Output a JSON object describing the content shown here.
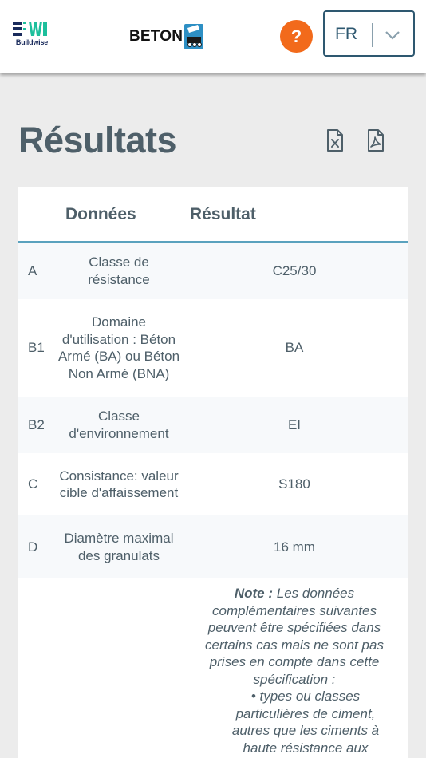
{
  "header": {
    "bw_brand": "Buildwise",
    "beton_brand": "BETON",
    "help_label": "?",
    "language": "FR"
  },
  "page": {
    "title": "Résultats"
  },
  "table": {
    "headers": [
      "Données",
      "Résultat"
    ],
    "rows": [
      {
        "code": "A",
        "label": "Classe de résistance",
        "value": "C25/30"
      },
      {
        "code": "B1",
        "label": "Domaine d'utilisation : Béton Armé (BA) ou Béton Non Armé (BNA)",
        "value": "BA"
      },
      {
        "code": "B2",
        "label": "Classe d'environnement",
        "value": "EI"
      },
      {
        "code": "C",
        "label": "Consistance: valeur cible d'affaissement",
        "value": "S180"
      },
      {
        "code": "D",
        "label": "Diamètre maximal des granulats",
        "value": "16 mm"
      }
    ],
    "note": {
      "prefix": "Note :",
      "text": "Les données complémentaires suivantes peuvent être spécifiées dans certains cas mais ne sont pas prises en compte dans cette spécification :",
      "bullets": [
        "types ou classes particulières de ciment, autres que les ciments à haute résistance aux"
      ]
    }
  },
  "colors": {
    "accent_orange": "#f26a1b",
    "border_blue": "#2e5870",
    "header_rule": "#5aa2be"
  }
}
